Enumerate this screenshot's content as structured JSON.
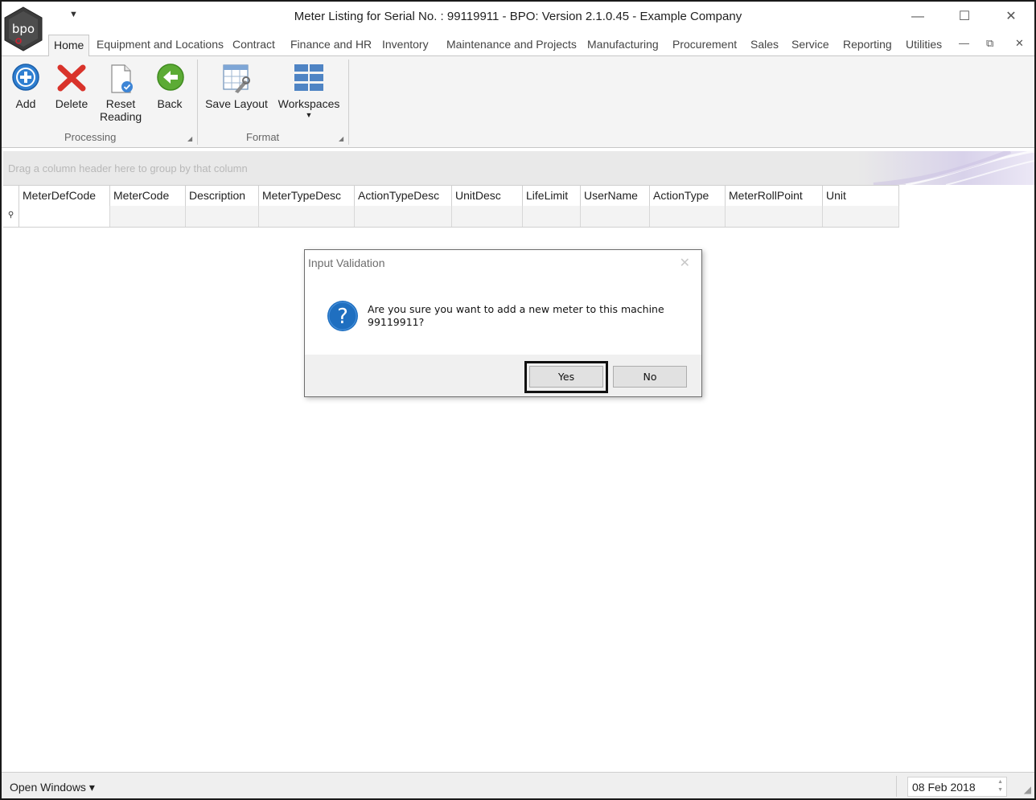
{
  "window": {
    "title": "Meter Listing for Serial No. : 99119911 - BPO: Version 2.1.0.45 - Example Company",
    "logo_text": "bpo",
    "qat_glyph": "▼",
    "min_glyph": "—",
    "max_glyph": "☐",
    "close_glyph": "✕"
  },
  "tabs": [
    {
      "label": "Home",
      "active": true
    },
    {
      "label": "Equipment and Locations"
    },
    {
      "label": "Contract"
    },
    {
      "label": "Finance and HR"
    },
    {
      "label": "Inventory"
    },
    {
      "label": "Maintenance and Projects"
    },
    {
      "label": "Manufacturing"
    },
    {
      "label": "Procurement"
    },
    {
      "label": "Sales"
    },
    {
      "label": "Service"
    },
    {
      "label": "Reporting"
    },
    {
      "label": "Utilities"
    }
  ],
  "mdi_controls": {
    "minimize": "—",
    "restore": "⧉",
    "close": "✕"
  },
  "ribbon": {
    "processing": {
      "label": "Processing",
      "add": "Add",
      "delete": "Delete",
      "reset_reading": "Reset\nReading",
      "back": "Back"
    },
    "format": {
      "label": "Format",
      "save_layout": "Save Layout",
      "workspaces": "Workspaces",
      "workspaces_arrow": "▼"
    },
    "launcher": "◢"
  },
  "grid": {
    "group_hint": "Drag a column header here to group by that column",
    "filter_icon": "⚲",
    "columns": [
      "MeterDefCode",
      "MeterCode",
      "Description",
      "MeterTypeDesc",
      "ActionTypeDesc",
      "UnitDesc",
      "LifeLimit",
      "UserName",
      "ActionType",
      "MeterRollPoint",
      "Unit"
    ]
  },
  "dialog": {
    "title": "Input Validation",
    "close": "✕",
    "icon": "question-icon",
    "icon_glyph": "?",
    "message": "Are you sure you want to add a new meter to this machine 99119911?",
    "yes": "Yes",
    "no": "No"
  },
  "statusbar": {
    "open_windows": "Open Windows ▾",
    "date": "08 Feb 2018",
    "spin_up": "▲",
    "spin_down": "▼",
    "grip": "◢"
  },
  "colors": {
    "accent_blue": "#1f6fc0",
    "delete_red": "#d9332b",
    "back_green": "#58a632",
    "ribbon_bg": "#f4f4f4"
  }
}
